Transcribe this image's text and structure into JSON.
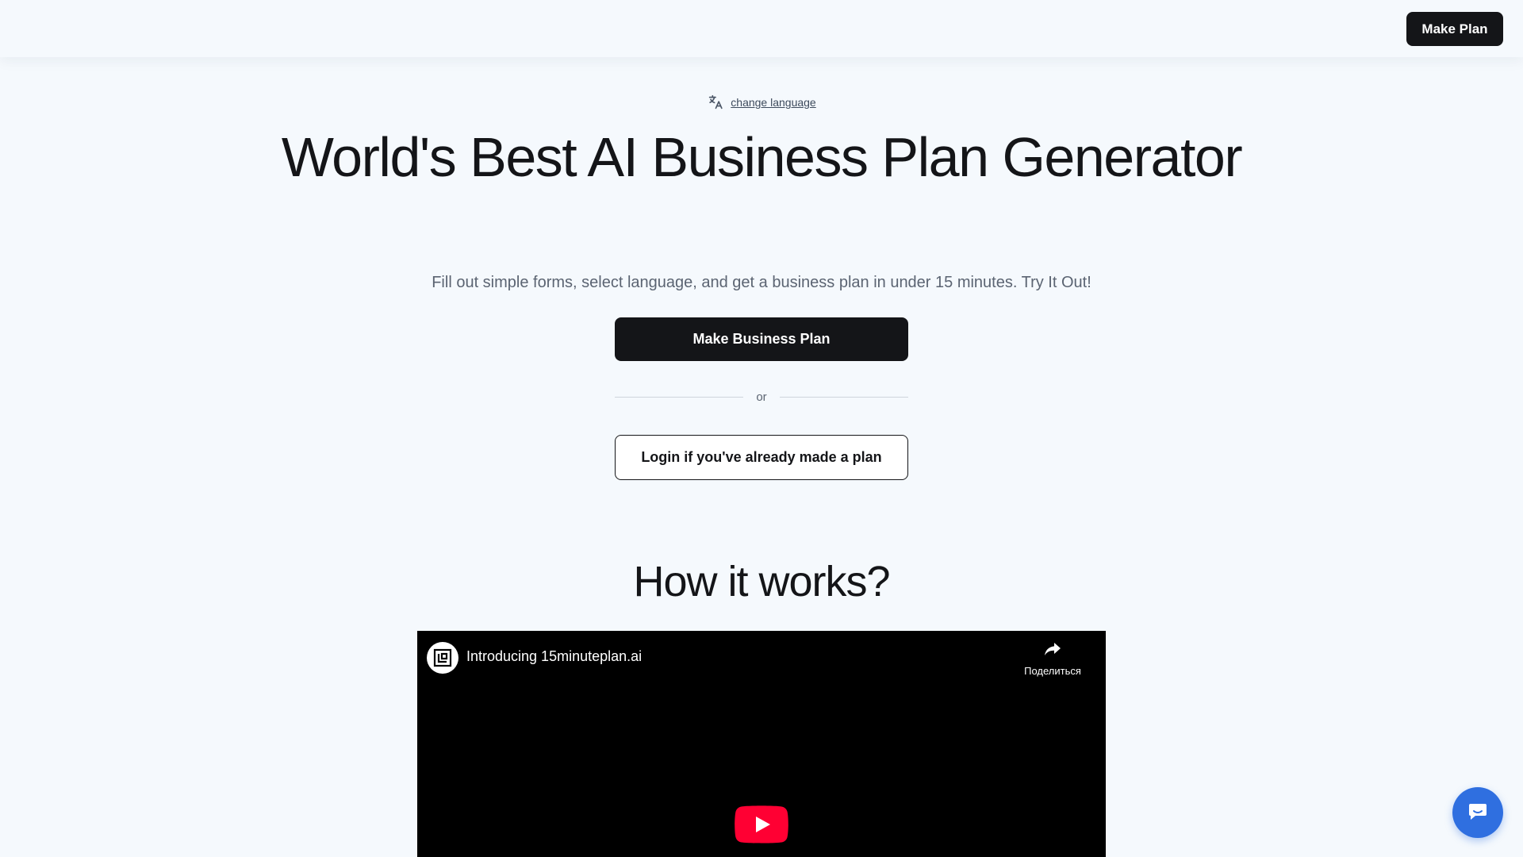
{
  "header": {
    "cta_label": "Make Plan"
  },
  "language": {
    "icon": "translate-icon",
    "link_label": "change language"
  },
  "hero": {
    "title": "World's Best AI Business Plan Generator",
    "subtitle": "Fill out simple forms, select language, and get a business plan in under 15 minutes. Try It Out!",
    "primary_cta": "Make Business Plan",
    "divider_text": "or",
    "secondary_cta": "Login if you've already made a plan"
  },
  "how_it_works": {
    "title": "How it works?"
  },
  "video": {
    "title": "Introducing 15minuteplan.ai",
    "share_label": "Поделиться",
    "channel_icon": "channel-logo-icon",
    "play_icon": "youtube-play-icon"
  },
  "chat": {
    "icon": "chat-bubble-icon"
  },
  "colors": {
    "page_background": "#f5f9fd",
    "primary_button": "#141518",
    "chat_button": "#2f6fe0",
    "youtube_red": "#ff0033"
  }
}
